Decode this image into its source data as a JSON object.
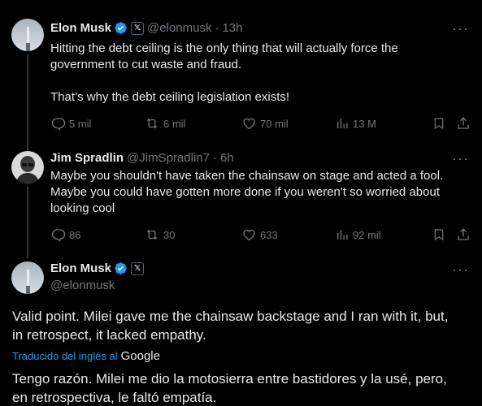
{
  "tweet1": {
    "name": "Elon Musk",
    "handle": "@elonmusk",
    "dot": "·",
    "time": "13h",
    "text_line1": "Hitting the debt ceiling is the only thing that will actually force the",
    "text_line2": "government to cut waste and fraud.",
    "text_line3": "That’s why the debt ceiling legislation exists!",
    "replies": "5 mil",
    "reposts": "6 mil",
    "likes": "70 mil",
    "views": "13 M"
  },
  "tweet2": {
    "name": "Jim Spradlin",
    "handle": "@JimSpradlin7",
    "dot": "·",
    "time": "6h",
    "text_line1": "Maybe you shouldn't have taken the chainsaw on stage and acted a fool.",
    "text_line2": "Maybe you could have gotten more done if you weren't so worried about",
    "text_line3": "looking cool",
    "replies": "86",
    "reposts": "30",
    "likes": "633",
    "views": "92 mil"
  },
  "tweet3": {
    "name": "Elon Musk",
    "handle": "@elonmusk",
    "text_line1": "Valid point. Milei gave me the chainsaw backstage and I ran with it, but,",
    "text_line2": "in retrospect, it lacked empathy.",
    "translated_label": "Traducido del inglés al",
    "google": "Google",
    "translation_line1": "Tengo razón. Milei me dio la motosierra entre bastidores y la usé, pero,",
    "translation_line2": "en retrospectiva, le faltó empatía."
  },
  "colors": {
    "background": "#000000",
    "text": "#e7e9ea",
    "muted": "#71767b",
    "verified": "#1d9bf0",
    "link": "#1d9bf0"
  },
  "icons": [
    "more-icon",
    "verified-icon",
    "x-badge-icon",
    "reply-icon",
    "repost-icon",
    "like-icon",
    "views-icon",
    "bookmark-icon",
    "share-icon"
  ]
}
